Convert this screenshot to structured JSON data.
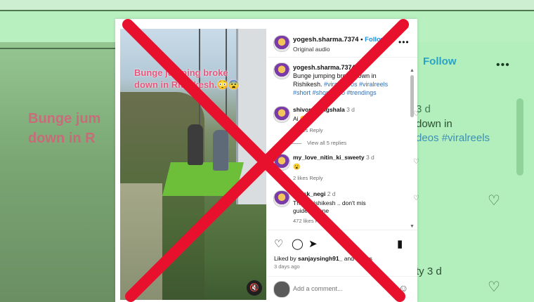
{
  "background": {
    "photo_text": "Bunge jum\ndown in R",
    "follow": "Follow",
    "more": "•••",
    "line1": "3 d",
    "line2": "down in",
    "line3": "deos #viralreels",
    "line4": "ty 3 d"
  },
  "post": {
    "username": "yogesh.sharma.7374",
    "separator": "•",
    "follow_label": "Follow",
    "audio": "Original audio",
    "more_label": "•••",
    "video_overlay_text": "Bunge jumping broke down in Rishikesh.😳😨",
    "mute_icon": "🔇"
  },
  "caption": {
    "username": "yogesh.sharma.7374",
    "text": "Bunge jumping broke down in Rishikesh.",
    "hashtags": "#viralvideos #viralreels #short #shortvideo #trendings"
  },
  "comments": [
    {
      "user": "shivom_singshala",
      "age": "3 d",
      "text": "Ai 😅",
      "meta": "2 likes   Reply"
    },
    {
      "user": "my_love_nitin_ki_sweety",
      "age": "3 d",
      "text": "😮",
      "meta": "2 likes   Reply"
    },
    {
      "user": "im_sk_negi",
      "age": "2 d",
      "text": "This is rishikesh .. don't mis guide anyone",
      "meta": "472 likes   Reply"
    }
  ],
  "view_replies": "View all 5 replies",
  "liked_by_prefix": "Liked by",
  "liked_by_user": "sanjaysingh91_",
  "liked_by_suffix": "and others",
  "posted_time": "3 days ago",
  "add_comment_placeholder": "Add a comment...",
  "colors": {
    "overlay_x": "#e8112d",
    "accent": "#1b8fe0",
    "background": "#b9f0c0"
  }
}
